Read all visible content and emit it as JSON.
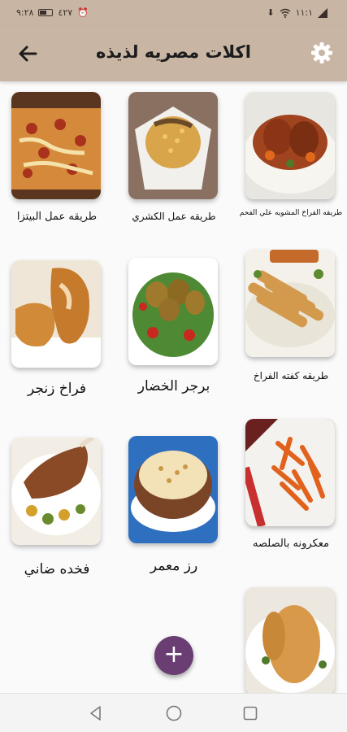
{
  "status_bar": {
    "time": "٩:٢٨",
    "network": "٤٢٧",
    "signal": "١١:١",
    "wifi": "wifi-icon",
    "download": "download-icon"
  },
  "app_bar": {
    "title": "اكلات مصريه لذيذه",
    "back_icon": "arrow-back-icon",
    "settings_icon": "gear-icon"
  },
  "recipes": [
    {
      "label": "طريقه الفراخ المشويه علي الفحم",
      "image": "grilled-chicken"
    },
    {
      "label": "طريقه عمل الكشري",
      "image": "koshari"
    },
    {
      "label": "طريقه عمل البيتزا",
      "image": "pizza"
    },
    {
      "label": "طريقه كفته الفراخ",
      "image": "chicken-kofta"
    },
    {
      "label": "برجر الخضار",
      "image": "veggie-burger"
    },
    {
      "label": "فراخ زنجر",
      "image": "zinger-chicken"
    },
    {
      "label": "معكرونه بالصلصه",
      "image": "pasta"
    },
    {
      "label": "رز معمر",
      "image": "baked-rice"
    },
    {
      "label": "فخده ضاني",
      "image": "lamb-leg"
    },
    {
      "label": "",
      "image": "roast-chicken"
    }
  ],
  "fab": {
    "label": "+",
    "icon": "add-icon"
  },
  "nav": {
    "back": "nav-back-icon",
    "home": "nav-home-icon",
    "recents": "nav-recents-icon"
  },
  "colors": {
    "app_bar": "#c9b5a3",
    "fab": "#6b3e73"
  }
}
